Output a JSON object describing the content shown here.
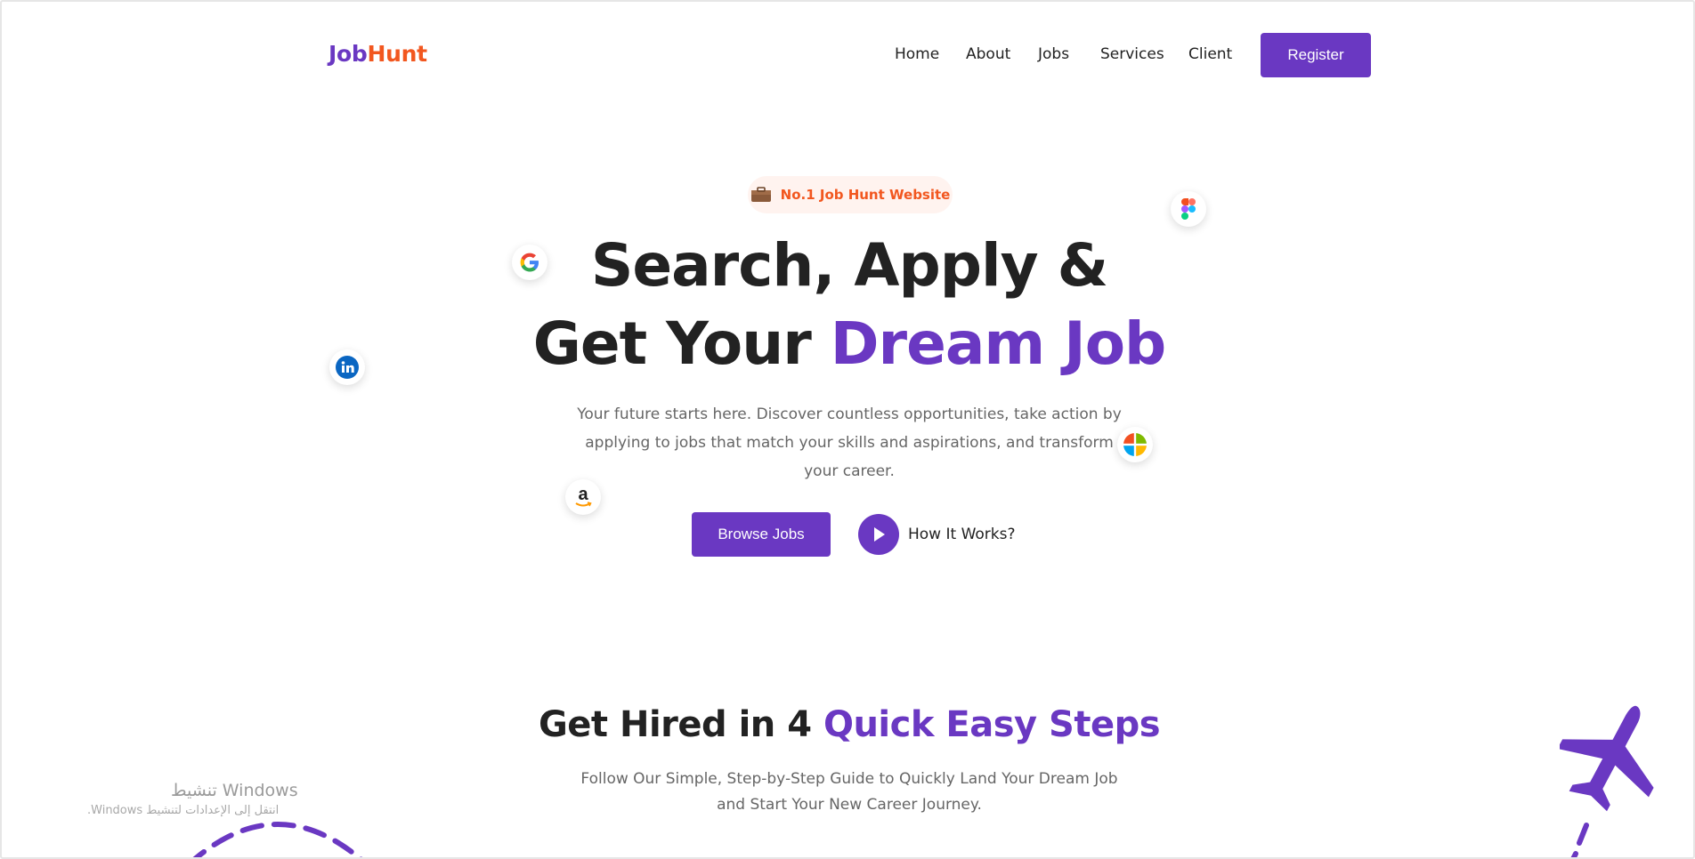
{
  "header": {
    "logo": {
      "part1": "Job",
      "part2": "Hunt"
    },
    "nav": [
      "Home",
      "About",
      "Jobs",
      "Services",
      "Client"
    ],
    "register_label": "Register"
  },
  "hero": {
    "badge": "No.1 Job Hunt Website",
    "title_line1": "Search, Apply &",
    "title_line2_plain": "Get Your ",
    "title_line2_accent": "Dream Job",
    "description": "Your future starts here. Discover countless opportunities, take action by applying to jobs that match your skills and aspirations, and transform your career.",
    "browse_label": "Browse Jobs",
    "how_label": "How It Works?",
    "floating_icons": [
      "google-icon",
      "figma-icon",
      "linkedin-icon",
      "windows-icon",
      "amazon-icon"
    ]
  },
  "steps": {
    "title_plain": "Get Hired in 4 ",
    "title_accent": "Quick Easy Steps",
    "description": "Follow Our Simple, Step-by-Step Guide to Quickly Land Your Dream Job and Start Your New Career Journey."
  },
  "watermark": {
    "title": "تنشيط Windows",
    "subtitle": "انتقل إلى الإعدادات لتنشيط Windows."
  },
  "colors": {
    "brand_purple": "#6a38c2",
    "brand_orange": "#f2571f",
    "text_dark": "#222222",
    "text_muted": "#666666"
  }
}
